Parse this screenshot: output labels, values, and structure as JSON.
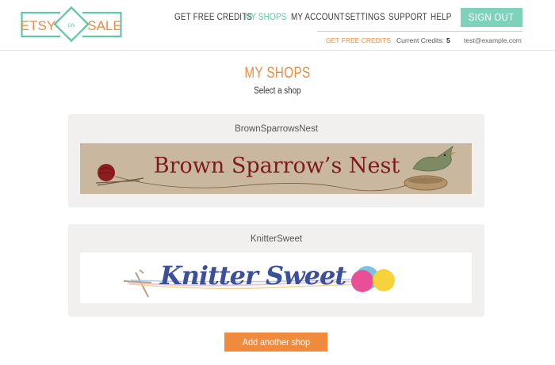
{
  "logo": {
    "left": "ETSY",
    "middle": "ON",
    "right": "SALE"
  },
  "nav": {
    "items": [
      {
        "label": "GET FREE CREDITS"
      },
      {
        "label": "MY SHOPS"
      },
      {
        "label": "MY ACCOUNT"
      },
      {
        "label": "SETTINGS"
      },
      {
        "label": "SUPPORT"
      },
      {
        "label": "HELP"
      }
    ],
    "sign_out": "SIGN OUT"
  },
  "subnav": {
    "free_credits": "GET FREE CREDITS",
    "credits_label": "Current Credits:",
    "credits_value": "5",
    "email": "test@example.com"
  },
  "page": {
    "title": "MY SHOPS",
    "subtitle": "Select a shop"
  },
  "shops": [
    {
      "name": "BrownSparrowsNest",
      "banner_text": "Brown Sparrow’s Nest"
    },
    {
      "name": "KnitterSweet",
      "banner_text": "Knitter Sweet"
    }
  ],
  "add_shop": "Add another shop",
  "colors": {
    "accent_orange": "#f08a3c",
    "accent_teal": "#5ec8a9",
    "signout_bg": "#7ed2bb",
    "card_bg": "#f1f0ee"
  }
}
